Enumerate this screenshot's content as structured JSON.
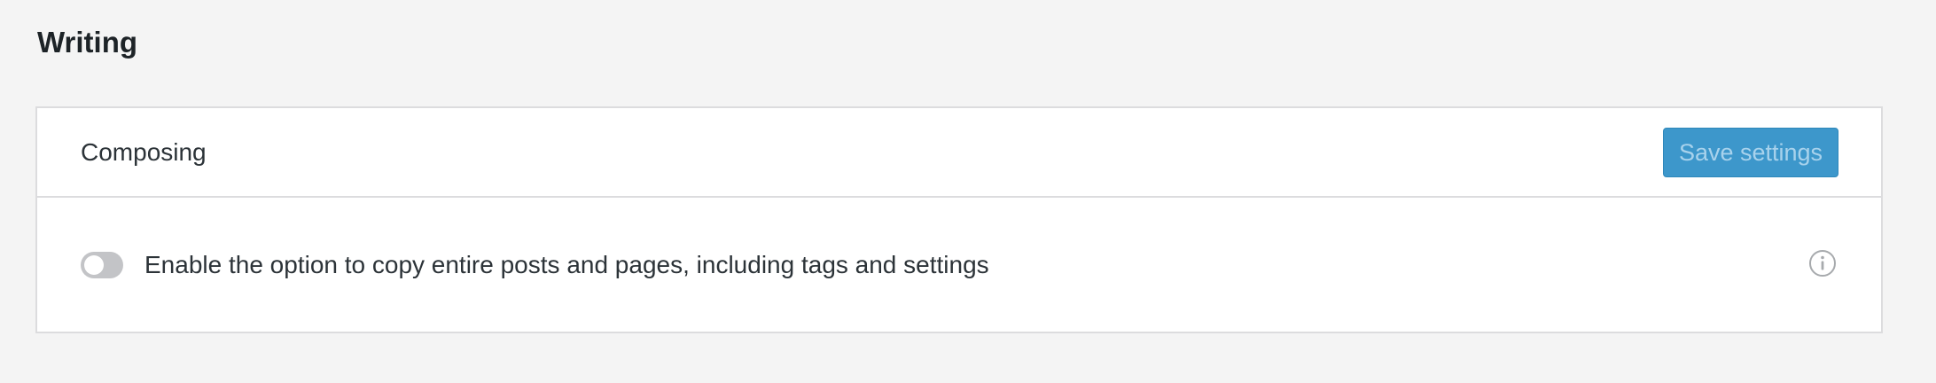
{
  "page": {
    "title": "Writing"
  },
  "section": {
    "title": "Composing",
    "save_button_label": "Save settings"
  },
  "settings": [
    {
      "label": "Enable the option to copy entire posts and pages, including tags and settings",
      "enabled": false,
      "icon": "info-icon"
    }
  ],
  "colors": {
    "primary_button": "#3d97cb",
    "button_text_disabled": "#a8d2ec",
    "toggle_off": "#c3c4c7",
    "background": "#f4f4f4"
  }
}
